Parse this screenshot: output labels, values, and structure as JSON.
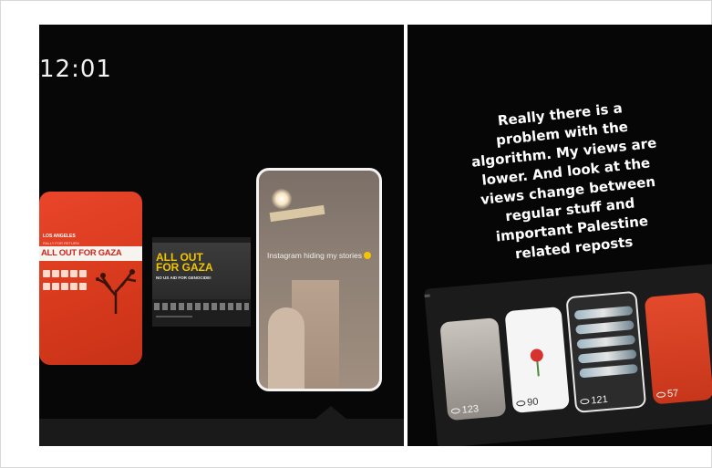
{
  "left_panel": {
    "time": "12:01",
    "story1": {
      "kicker": "LOS ANGELES",
      "subkicker": "RALLY FOR RETURN",
      "headline": "ALL OUT FOR GAZA"
    },
    "story2": {
      "headline_line1": "ALL OUT",
      "headline_line2": "FOR GAZA",
      "subheadline": "NO US AID FOR GENOCIDE!"
    },
    "story3": {
      "caption": "Instagram hiding my stories"
    }
  },
  "right_panel": {
    "message": "Really there is a problem with the algorithm. My views are lower. And look at the views change between regular stuff and important Palestine related reposts",
    "thumbnails": [
      {
        "views": "123"
      },
      {
        "views": "90"
      },
      {
        "views": "121"
      },
      {
        "views": "57"
      }
    ]
  },
  "colors": {
    "background": "#070707",
    "poster_red": "#e9452a",
    "poster_yellow": "#f1c500",
    "text_white": "#ffffff"
  },
  "icons": [
    "eye-icon",
    "smile-emoji-icon"
  ]
}
